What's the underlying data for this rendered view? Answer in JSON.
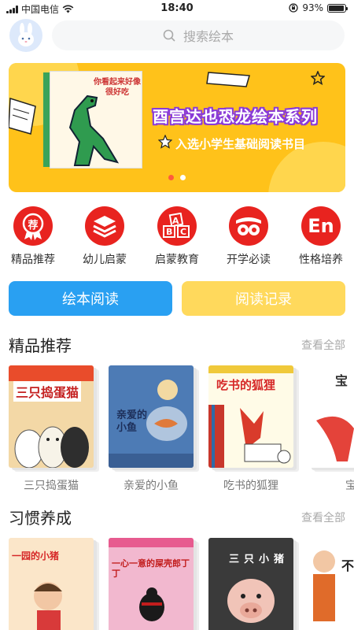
{
  "status_bar": {
    "carrier": "中国电信",
    "time": "18:40",
    "battery": "93%"
  },
  "header": {
    "avatar_icon": "rabbit-icon",
    "search_placeholder": "搜索绘本"
  },
  "banner": {
    "book_title": "你看起来好像很好吃",
    "title": "酉宫达也恐龙绘本系列",
    "subtitle": "入选小学生基础阅读书目",
    "page_count": 2,
    "active_page": 1
  },
  "categories": [
    {
      "label": "精品推荐",
      "icon": "recommend-badge-icon",
      "glyph": "荐"
    },
    {
      "label": "幼儿启蒙",
      "icon": "layers-icon",
      "glyph": ""
    },
    {
      "label": "启蒙教育",
      "icon": "abc-blocks-icon",
      "glyph": ""
    },
    {
      "label": "开学必读",
      "icon": "school-icon",
      "glyph": ""
    },
    {
      "label": "性格培养",
      "icon": "english-icon",
      "glyph": "En"
    }
  ],
  "buttons": {
    "read": "绘本阅读",
    "history": "阅读记录"
  },
  "sections": [
    {
      "title": "精品推荐",
      "more": "查看全部",
      "books": [
        {
          "name": "三只捣蛋猫",
          "cover_title": "三只捣蛋猫"
        },
        {
          "name": "亲爱的小鱼",
          "cover_title": "亲爱的小鱼"
        },
        {
          "name": "吃书的狐狸",
          "cover_title": "吃书的狐狸"
        },
        {
          "name": "宝",
          "cover_title": "宝"
        }
      ]
    },
    {
      "title": "习惯养成",
      "more": "查看全部",
      "books": [
        {
          "name": "",
          "cover_title": "一园的小猪"
        },
        {
          "name": "",
          "cover_title": "一心一意的屎壳郎丁丁"
        },
        {
          "name": "",
          "cover_title": "三只小猪"
        },
        {
          "name": "",
          "cover_title": "不"
        }
      ]
    }
  ],
  "colors": {
    "accent_blue": "#29a0f2",
    "accent_yellow": "#ffd95c",
    "category_red": "#e8231f",
    "banner_yellow": "#ffc21a",
    "banner_purple": "#8a3bd8"
  }
}
